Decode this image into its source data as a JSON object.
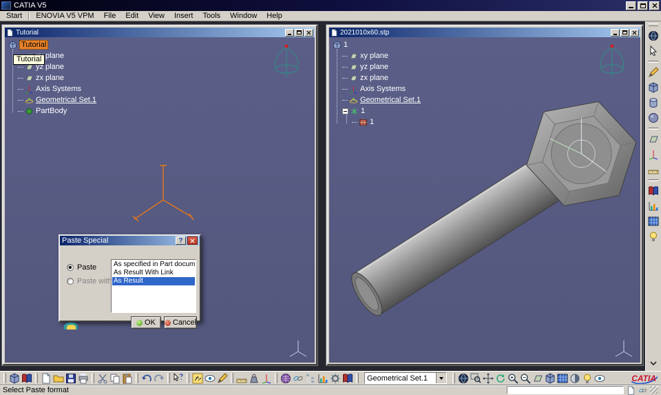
{
  "app": {
    "title": "CATIA V5",
    "menu": [
      "Start",
      "ENOVIA V5 VPM",
      "File",
      "Edit",
      "View",
      "Insert",
      "Tools",
      "Window",
      "Help"
    ]
  },
  "left_window": {
    "title": "Tutorial",
    "tooltip": "Tutorial",
    "tree": [
      {
        "label": "Tutorial"
      },
      {
        "label": "xy plane"
      },
      {
        "label": "yz plane"
      },
      {
        "label": "zx plane"
      },
      {
        "label": "Axis Systems"
      },
      {
        "label": "Geometrical Set.1"
      },
      {
        "label": "PartBody"
      }
    ]
  },
  "right_window": {
    "title": "2021010x60.stp",
    "tree": [
      {
        "label": "1"
      },
      {
        "label": "xy plane"
      },
      {
        "label": "yz plane"
      },
      {
        "label": "zx plane"
      },
      {
        "label": "Axis Systems"
      },
      {
        "label": "Geometrical Set.1"
      },
      {
        "label": "1"
      },
      {
        "label": "1"
      }
    ]
  },
  "dialog": {
    "title": "Paste Special",
    "paste_label": "Paste",
    "paste_link_label": "Paste with link",
    "options": [
      "As specified in Part document",
      "As Result With Link",
      "As Result"
    ],
    "selected": "As Result",
    "ok": "OK",
    "cancel": "Cancel",
    "help_glyph": "?"
  },
  "toolbar": {
    "combo_value": "Geometrical Set.1"
  },
  "statusbar": {
    "message": "Select Paste format"
  },
  "logo": "CATIA",
  "colors": {
    "viewport_bg": "#575b83",
    "titlebar_from": "#0a246a",
    "titlebar_to": "#a6caf0",
    "selection_blue": "#2e66c9",
    "highlight_orange": "#e8822a",
    "tooltip_bg": "#ffffe1",
    "compass_teal": "#2e8f85",
    "axis_orange": "#e0761f"
  }
}
